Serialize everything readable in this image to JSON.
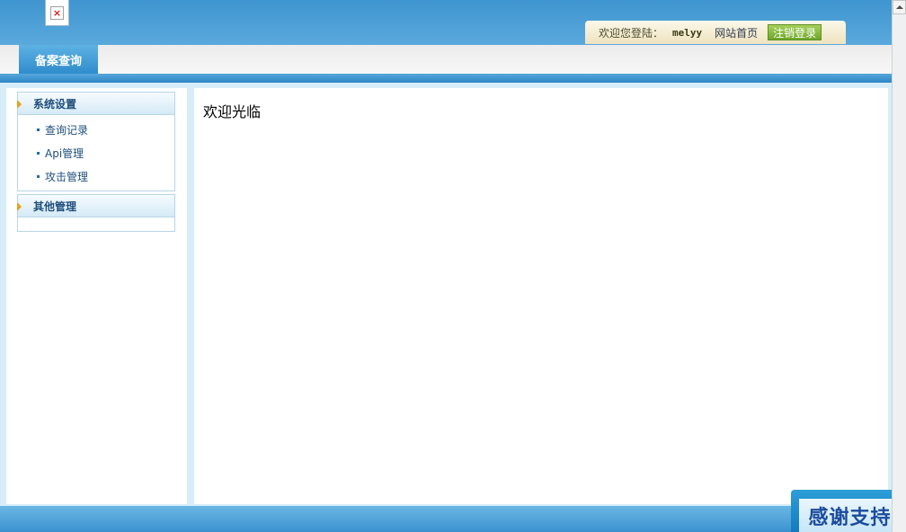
{
  "header": {
    "welcome_label": "欢迎您登陆：",
    "username": "melyy",
    "home_link": "网站首页",
    "logout_button": "注销登录"
  },
  "tabs": [
    {
      "label": "备案查询"
    }
  ],
  "sidebar": {
    "groups": [
      {
        "title": "系统设置",
        "items": [
          {
            "label": "查询记录"
          },
          {
            "label": "Api管理"
          },
          {
            "label": "攻击管理"
          }
        ]
      },
      {
        "title": "其他管理",
        "items": []
      }
    ]
  },
  "content": {
    "welcome_text": "欢迎光临"
  },
  "footer": {
    "support_badge": "感谢支持"
  },
  "colors": {
    "header_blue": "#4aa0d6",
    "tab_blue": "#3b95d0",
    "menu_text": "#1e4e7c",
    "menu_arrow": "#e7a11b",
    "logout_green": "#7fb935"
  },
  "icons": {
    "logo": "broken-image-icon",
    "menu_arrow": "triangle-right-icon",
    "menu_bullet": "square-bullet-icon",
    "scroll_up": "scroll-up-arrow-icon"
  }
}
